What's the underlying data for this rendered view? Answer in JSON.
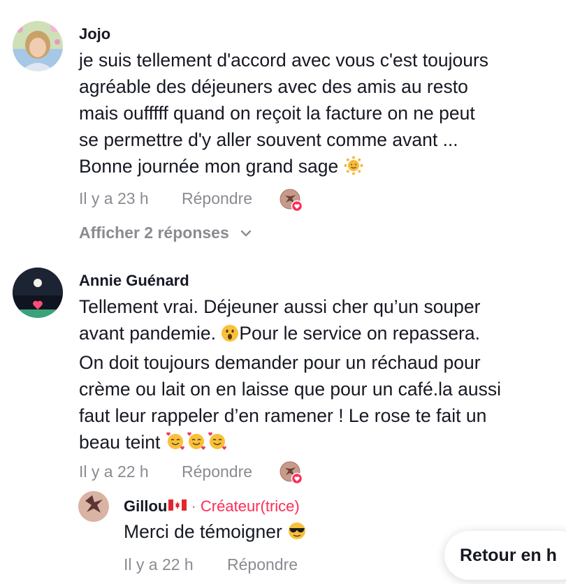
{
  "comments": [
    {
      "author": "Jojo",
      "text": "je suis tellement d'accord avec vous c'est toujours\nagréable des déjeuners avec des amis au resto\nmais oufffff quand on reçoit la facture on ne peut\nse permettre d'y aller souvent comme avant ...\nBonne journée mon grand sage",
      "emoji_icon": "sun-face-emoji",
      "time": "Il y a 23 h",
      "reply_label": "Répondre",
      "show_replies": "Afficher 2 réponses"
    },
    {
      "author": "Annie Guénard",
      "text_part1": "Tellement vrai. Déjeuner aussi cher qu’un souper\navant pandemie. ",
      "text_part2": "Pour le service on repassera.\nOn doit toujours demander pour un réchaud pour\ncrème ou lait on en laisse que pour un café.la aussi\nfaut leur rappeler d’en ramener ! Le rose te fait un\nbeau teint",
      "time": "Il y a 22 h",
      "reply_label": "Répondre"
    }
  ],
  "reply": {
    "author": "Gillou",
    "separator": "·",
    "creator_label": "Créateur(trice)",
    "text": "Merci de témoigner",
    "time": "Il y a 22 h",
    "reply_label": "Répondre"
  },
  "back_to_top_label": "Retour en h",
  "colors": {
    "accent": "#fe2c55",
    "muted": "#8a8b91",
    "text": "#161823"
  }
}
